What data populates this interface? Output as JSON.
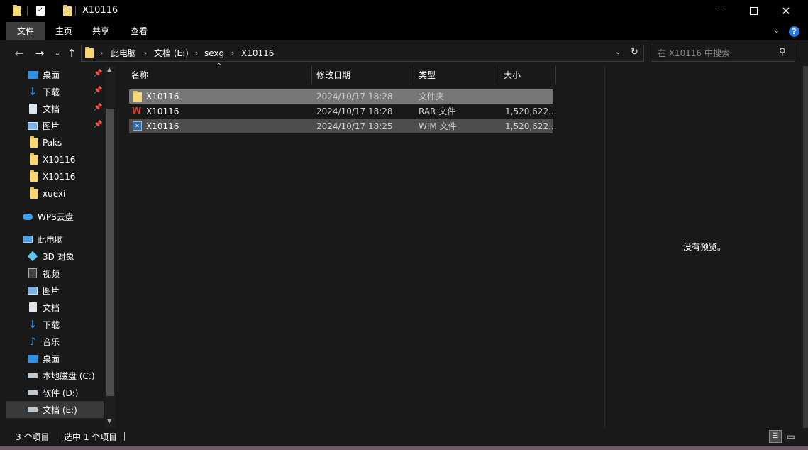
{
  "window": {
    "title": "X10116"
  },
  "ribbon": {
    "tabs": [
      "文件",
      "主页",
      "共享",
      "查看"
    ]
  },
  "address": {
    "crumbs": [
      "此电脑",
      "文档 (E:)",
      "sexg",
      "X10116"
    ],
    "search_placeholder": "在 X10116 中搜索"
  },
  "sidebar": {
    "quick_access": [
      {
        "label": "桌面",
        "icon": "desktop-icon",
        "pinned": true
      },
      {
        "label": "下载",
        "icon": "download-icon",
        "pinned": true
      },
      {
        "label": "文档",
        "icon": "document-icon",
        "pinned": true
      },
      {
        "label": "图片",
        "icon": "picture-icon",
        "pinned": true
      },
      {
        "label": "Paks",
        "icon": "folder-icon",
        "pinned": false
      },
      {
        "label": "X10116",
        "icon": "folder-icon",
        "pinned": false
      },
      {
        "label": "X10116",
        "icon": "folder-icon",
        "pinned": false
      },
      {
        "label": "xuexi",
        "icon": "folder-icon",
        "pinned": false
      }
    ],
    "wps_cloud": "WPS云盘",
    "this_pc": "此电脑",
    "pc_items": [
      {
        "label": "3D 对象",
        "icon": "3d-objects-icon"
      },
      {
        "label": "视频",
        "icon": "video-icon"
      },
      {
        "label": "图片",
        "icon": "picture-icon"
      },
      {
        "label": "文档",
        "icon": "document-icon"
      },
      {
        "label": "下载",
        "icon": "download-icon"
      },
      {
        "label": "音乐",
        "icon": "music-icon"
      },
      {
        "label": "桌面",
        "icon": "desktop-icon"
      },
      {
        "label": "本地磁盘 (C:)",
        "icon": "drive-c-icon"
      },
      {
        "label": "软件 (D:)",
        "icon": "drive-icon"
      },
      {
        "label": "文档 (E:)",
        "icon": "drive-icon",
        "selected": true
      }
    ]
  },
  "columns": {
    "name": "名称",
    "date": "修改日期",
    "type": "类型",
    "size": "大小"
  },
  "files": [
    {
      "name": "X10116",
      "date": "2024/10/17 18:28",
      "type": "文件夹",
      "size": "",
      "icon": "folder-icon",
      "state": "hover"
    },
    {
      "name": "X10116",
      "date": "2024/10/17 18:28",
      "type": "RAR 文件",
      "size": "1,520,622...",
      "icon": "wps-rar-icon",
      "state": "normal"
    },
    {
      "name": "X10116",
      "date": "2024/10/17 18:25",
      "type": "WIM 文件",
      "size": "1,520,622...",
      "icon": "wim-file-icon",
      "state": "selected"
    }
  ],
  "preview": {
    "text": "没有预览。"
  },
  "status": {
    "count": "3 个项目",
    "selection": "选中 1 个项目"
  },
  "colors": {
    "accent": "#0078d7",
    "selected_row": "#4d4d4d",
    "hover_row": "#777777"
  }
}
